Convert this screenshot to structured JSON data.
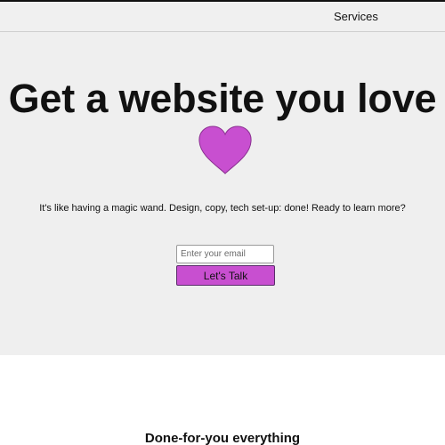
{
  "nav": {
    "services_label": "Services"
  },
  "hero": {
    "title": "Get a website you love",
    "heart_icon": "heart-icon",
    "subtitle": "It's like having a magic wand. Design, copy, tech set-up: done! Ready to learn more?",
    "email_placeholder": "Enter your email",
    "email_value": "",
    "cta_label": "Let's Talk"
  },
  "section": {
    "title": "Done-for-you everything"
  },
  "colors": {
    "accent": "#c84fd0",
    "hero_background": "#efefef",
    "nav_background": "#f0f0f0"
  }
}
